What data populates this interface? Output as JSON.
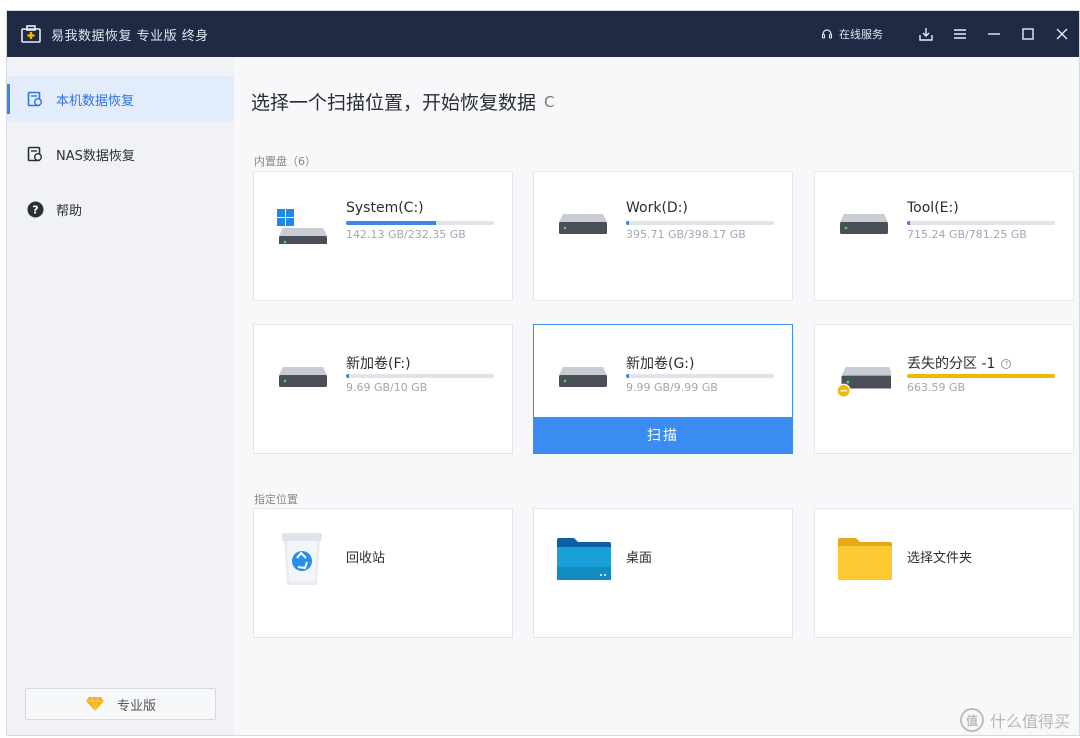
{
  "titlebar": {
    "title": "易我数据恢复 专业版 终身",
    "online_service": "在线服务",
    "icons": [
      "download-icon",
      "menu-icon",
      "minimize-icon",
      "maximize-icon",
      "close-icon"
    ]
  },
  "sidebar": {
    "items": [
      {
        "label": "本机数据恢复",
        "icon": "local-recovery-icon",
        "active": true
      },
      {
        "label": "NAS数据恢复",
        "icon": "nas-recovery-icon",
        "active": false
      },
      {
        "label": "帮助",
        "icon": "help-icon",
        "active": false
      }
    ],
    "pro_label": "专业版"
  },
  "main": {
    "title": "选择一个扫描位置，开始恢复数据",
    "refresh_glyph": "C",
    "internal_label": "内置盘（6）",
    "drives": [
      {
        "name": "System(C:)",
        "size": "142.13 GB/232.35 GB",
        "used_fraction": 0.61,
        "windows_logo": true
      },
      {
        "name": "Work(D:)",
        "size": "395.71 GB/398.17 GB",
        "used_fraction": 0.02
      },
      {
        "name": "Tool(E:)",
        "size": "715.24 GB/781.25 GB",
        "used_fraction": 0.02
      },
      {
        "name": "新加卷(F:)",
        "size": "9.69 GB/10 GB",
        "used_fraction": 0.02
      },
      {
        "name": "新加卷(G:)",
        "size": "9.99 GB/9.99 GB",
        "used_fraction": 0.02,
        "selected": true
      },
      {
        "name": "丢失的分区 -1",
        "size": "663.59 GB",
        "used_fraction": 1.0,
        "lost": true
      }
    ],
    "scan_label": "扫描",
    "lost_help": "?",
    "location_label": "指定位置",
    "locations": [
      {
        "label": "回收站",
        "icon": "recycle-bin-icon"
      },
      {
        "label": "桌面",
        "icon": "desktop-folder-icon"
      },
      {
        "label": "选择文件夹",
        "icon": "folder-icon"
      }
    ]
  },
  "watermark": {
    "text": "什么值得买",
    "logo_text": "值"
  },
  "colors": {
    "titlebar": "#1f2a44",
    "accent": "#3b8cf0",
    "warn": "#f2b705"
  }
}
